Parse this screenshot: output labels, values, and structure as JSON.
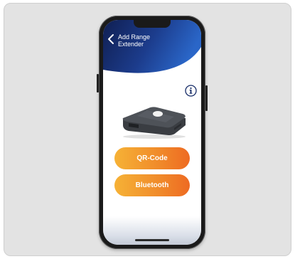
{
  "screen": {
    "title_line1": "Add Range",
    "title_line2": "Extender"
  },
  "buttons": {
    "qr_label": "QR-Code",
    "bluetooth_label": "Bluetooth"
  },
  "icons": {
    "back": "chevron-left-icon",
    "info": "info-icon"
  },
  "colors": {
    "header_dark": "#101f52",
    "header_mid": "#1c3c8c",
    "header_light": "#2a66c8",
    "button_start": "#f6b236",
    "button_end": "#ee6a22",
    "card_background": "#e3e3e3"
  }
}
